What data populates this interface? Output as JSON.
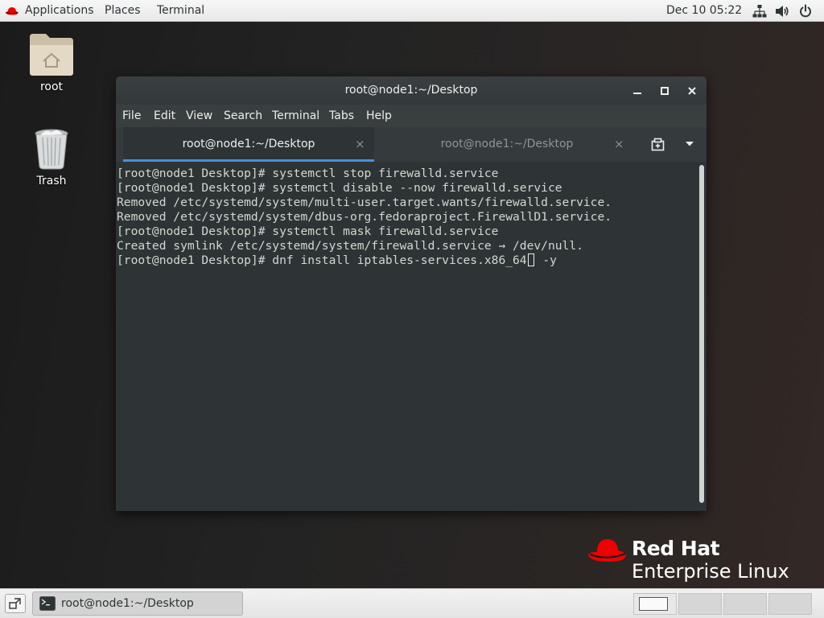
{
  "topbar": {
    "applications": "Applications",
    "places": "Places",
    "terminal": "Terminal",
    "clock": "Dec 10  05:22"
  },
  "desktop": {
    "icons": [
      {
        "label": "root",
        "icon": "home-folder-icon"
      },
      {
        "label": "Trash",
        "icon": "trash-icon"
      }
    ]
  },
  "window": {
    "title": "root@node1:~/Desktop",
    "menu": [
      "File",
      "Edit",
      "View",
      "Search",
      "Terminal",
      "Tabs",
      "Help"
    ],
    "tabs": [
      {
        "label": "root@node1:~/Desktop",
        "active": true
      },
      {
        "label": "root@node1:~/Desktop",
        "active": false
      }
    ],
    "close_glyph": "×"
  },
  "terminal": {
    "lines": [
      "[root@node1 Desktop]# systemctl stop firewalld.service",
      "[root@node1 Desktop]# systemctl disable --now firewalld.service",
      "Removed /etc/systemd/system/multi-user.target.wants/firewalld.service.",
      "Removed /etc/systemd/system/dbus-org.fedoraproject.FirewallD1.service.",
      "[root@node1 Desktop]# systemctl mask firewalld.service",
      "Created symlink /etc/systemd/system/firewalld.service → /dev/null."
    ],
    "current_before_cursor": "[root@node1 Desktop]# dnf install iptables-services.x86_64",
    "current_after_cursor": " -y"
  },
  "branding": {
    "line1": "Red Hat",
    "line2": "Enterprise Linux"
  },
  "taskbar": {
    "window_label": "root@node1:~/Desktop",
    "workspaces": 4
  },
  "colors": {
    "terminal_bg": "#2e3436",
    "terminal_fg": "#d3d7cf",
    "tab_accent": "#4a90d9",
    "redhat_red": "#ee0000"
  }
}
